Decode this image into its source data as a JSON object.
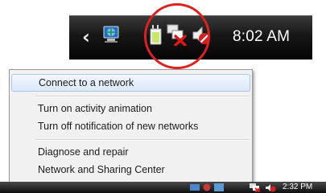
{
  "taskbar_top": {
    "clock": "8:02 AM",
    "icons": [
      "chevron-left-icon",
      "network-globe-icon",
      "battery-plug-icon",
      "network-disconnected-icon",
      "volume-muted-icon"
    ]
  },
  "menu": {
    "items": [
      {
        "label": "Connect to a network",
        "highlighted": true
      },
      {
        "label": "Turn on activity animation"
      },
      {
        "label": "Turn off notification of new networks"
      },
      {
        "label": "Diagnose and repair"
      },
      {
        "label": "Network and Sharing Center"
      }
    ]
  },
  "taskbar_bottom": {
    "clock": "2:32 PM",
    "icons": [
      "tray-icon-1",
      "tray-icon-2",
      "tray-icon-3",
      "network-disconnected-icon",
      "volume-muted-icon"
    ]
  },
  "colors": {
    "highlight_circle": "#e02020",
    "taskbar": "#111111",
    "menu_bg": "#f1f1f1",
    "menu_hover": "#dbe9f9"
  }
}
